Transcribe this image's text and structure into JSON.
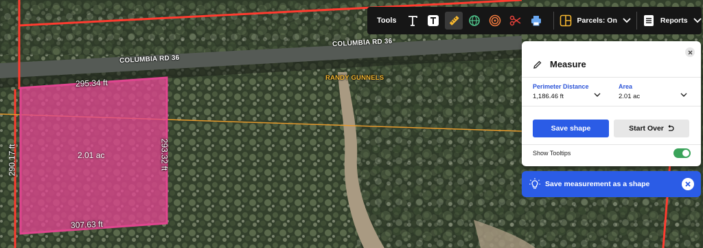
{
  "map": {
    "road_labels": [
      "COLUMBIA RD 36",
      "COLUMBIA RD 36"
    ],
    "owner_label": "RANDY GUNNELS",
    "parcel": {
      "top_dim": "295.34 ft",
      "bottom_dim": "307.63 ft",
      "left_dim": "290.17 ft",
      "right_dim": "293.32 ft",
      "area": "2.01 ac",
      "fill_color": "#e0458f"
    }
  },
  "toolbar": {
    "tools_label": "Tools",
    "icons": [
      "text-icon",
      "text-box-icon",
      "ruler-icon",
      "globe-icon",
      "buffer-ring-icon",
      "scissors-icon",
      "printer-icon"
    ],
    "parcels_label": "Parcels: On",
    "reports_label": "Reports"
  },
  "measure": {
    "title": "Measure",
    "perimeter_label": "Perimeter Distance",
    "perimeter_value": "1,186.46 ft",
    "area_label": "Area",
    "area_value": "2.01 ac",
    "save_button": "Save shape",
    "start_over_button": "Start Over",
    "tooltips_label": "Show Tooltips",
    "tooltips_on": true
  },
  "hint": {
    "text": "Save measurement as a shape"
  },
  "colors": {
    "accent": "#2b5ce6",
    "parcel_line": "#ff3b2f",
    "toggle_on": "#3aa35a"
  }
}
